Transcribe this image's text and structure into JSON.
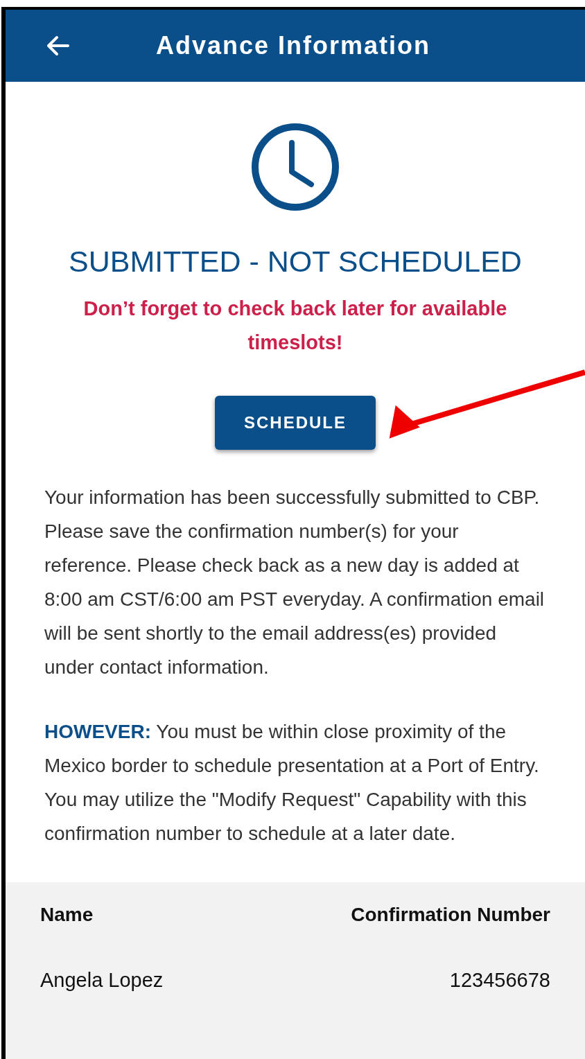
{
  "header": {
    "title": "Advance Information"
  },
  "status": {
    "title": "SUBMITTED - NOT SCHEDULED",
    "reminder": "Don’t forget to check back later for available timeslots!"
  },
  "schedule_button": {
    "label": "SCHEDULE"
  },
  "paragraphs": [
    "Your information has been successfully submitted to CBP. Please save the confirmation number(s) for your reference. Please check back as a new day is added at 8:00 am CST/6:00 am PST everyday. A confirmation email will be sent shortly to the email address(es) provided under contact information.",
    "**HOWEVER:** You must be within close proximity of the Mexico border to schedule presentation at a Port of Entry.  You may utilize the \"Modify Request\" Capability with this confirmation number to schedule at a later date."
  ],
  "table": {
    "columns": [
      "Name",
      "Confirmation Number"
    ],
    "rows": [
      [
        "Angela Lopez",
        "123456678"
      ]
    ]
  }
}
